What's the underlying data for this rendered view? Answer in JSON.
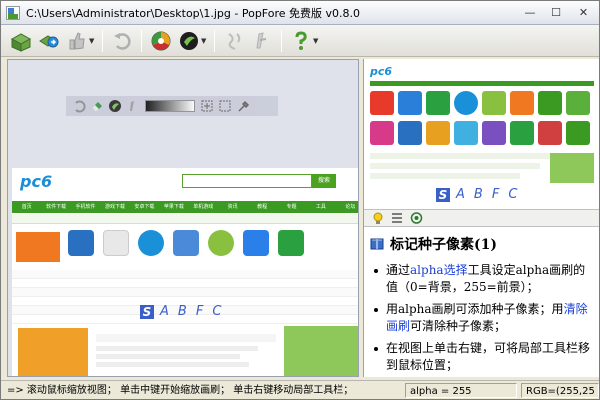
{
  "window": {
    "title": "C:\\Users\\Administrator\\Desktop\\1.jpg - PopFore 免费版 v0.8.0",
    "minimize": "—",
    "maximize": "☐",
    "close": "✕"
  },
  "toolbar": {
    "icons": [
      "open-icon",
      "save-icon",
      "thumbs-icon",
      "undo-icon",
      "color-wheel-icon",
      "brush-icon",
      "redo-icon",
      "pen-icon",
      "help-icon"
    ]
  },
  "overlay_left": {
    "s": "S",
    "letters": [
      "A",
      "B",
      "F",
      "C"
    ]
  },
  "overlay_right": {
    "s": "S",
    "letters": [
      "A",
      "B",
      "F",
      "C"
    ]
  },
  "webpage": {
    "logo": "pc6",
    "nav": [
      "首页",
      "软件下载",
      "手机软件",
      "游戏下载",
      "安卓下载",
      "苹果下载",
      "单机游戏",
      "资讯",
      "教程",
      "专题",
      "工具",
      "论坛"
    ],
    "search_btn": "搜索"
  },
  "thumb": {
    "logo": "pc6"
  },
  "help": {
    "title": "标记种子像素(1)",
    "items": [
      {
        "pre": "通过",
        "link": "alpha选择",
        "post": "工具设定alpha画刷的值（0=背景，255=前景）；"
      },
      {
        "pre": "用alpha画刷可添加种子像素；用",
        "link": "清除画刷",
        "post": "可清除种子像素；"
      },
      {
        "pre": "在视图上单击右键，可将局部工具栏移到鼠标位置；",
        "link": "",
        "post": ""
      }
    ]
  },
  "status": {
    "hint": "=> 滚动鼠标缩放视图； 单击中键开始缩放画刷； 单击右键移动局部工具栏；",
    "alpha": "alpha = 255",
    "rgb": "RGB=(255,25"
  }
}
